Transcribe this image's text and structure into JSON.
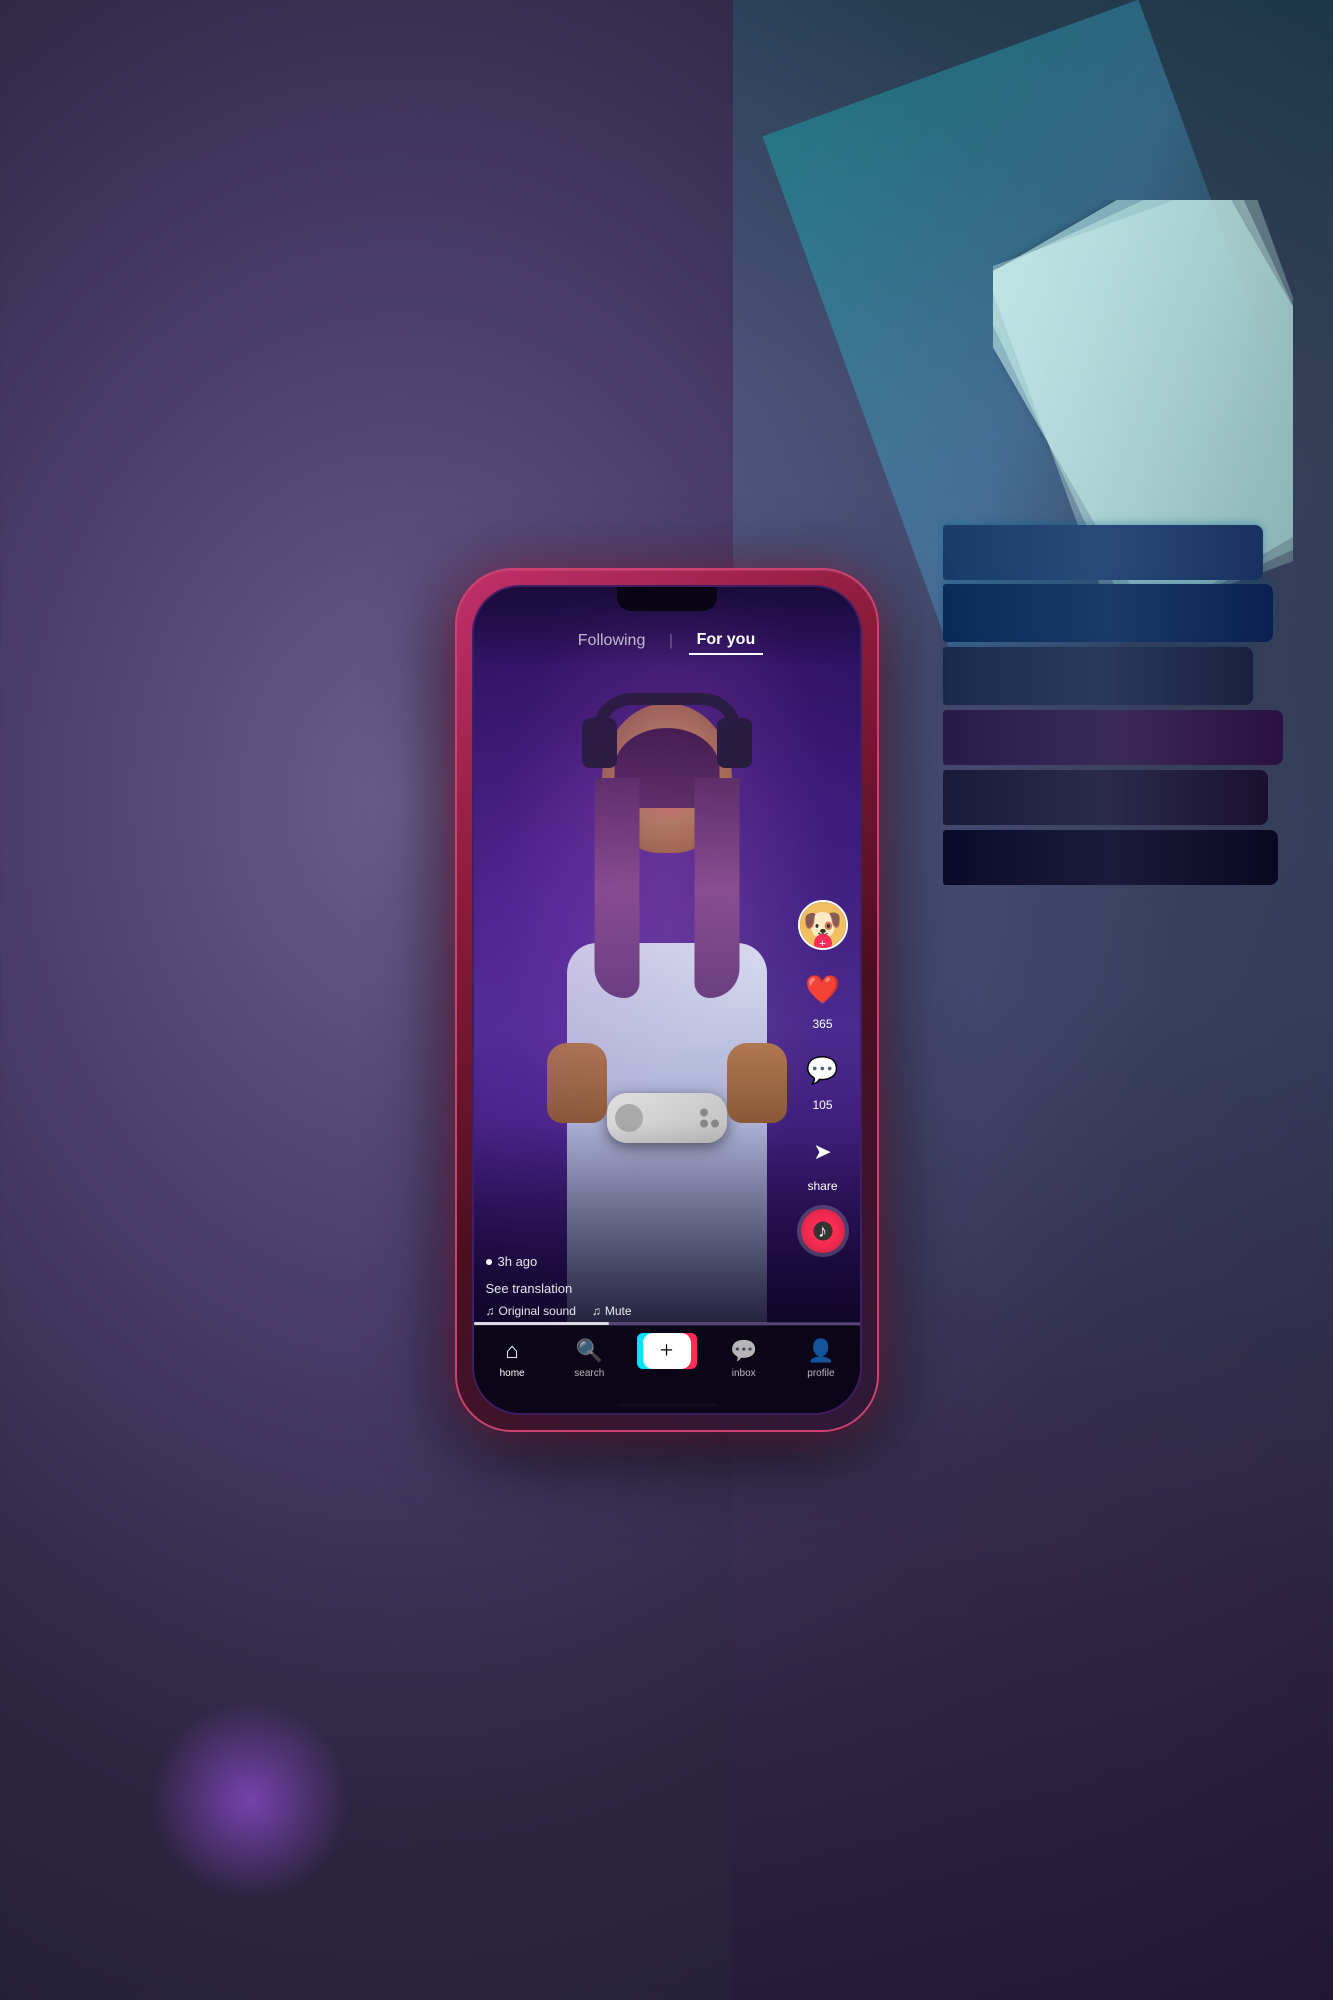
{
  "background": {
    "color1": "#6b5b8a",
    "color2": "#2d2540"
  },
  "phone": {
    "screen": {
      "topNav": {
        "following_label": "Following",
        "divider": "|",
        "for_you_label": "For you"
      },
      "video": {
        "time_ago": "3h ago",
        "see_translation": "See translation",
        "original_sound": "♫ Original sound",
        "mute": "♫ Mute"
      },
      "actions": {
        "likes": "365",
        "comments": "105",
        "share_label": "share"
      },
      "bottomNav": {
        "home_label": "home",
        "search_label": "search",
        "add_label": "+",
        "inbox_label": "inbox",
        "profile_label": "profile"
      }
    }
  }
}
